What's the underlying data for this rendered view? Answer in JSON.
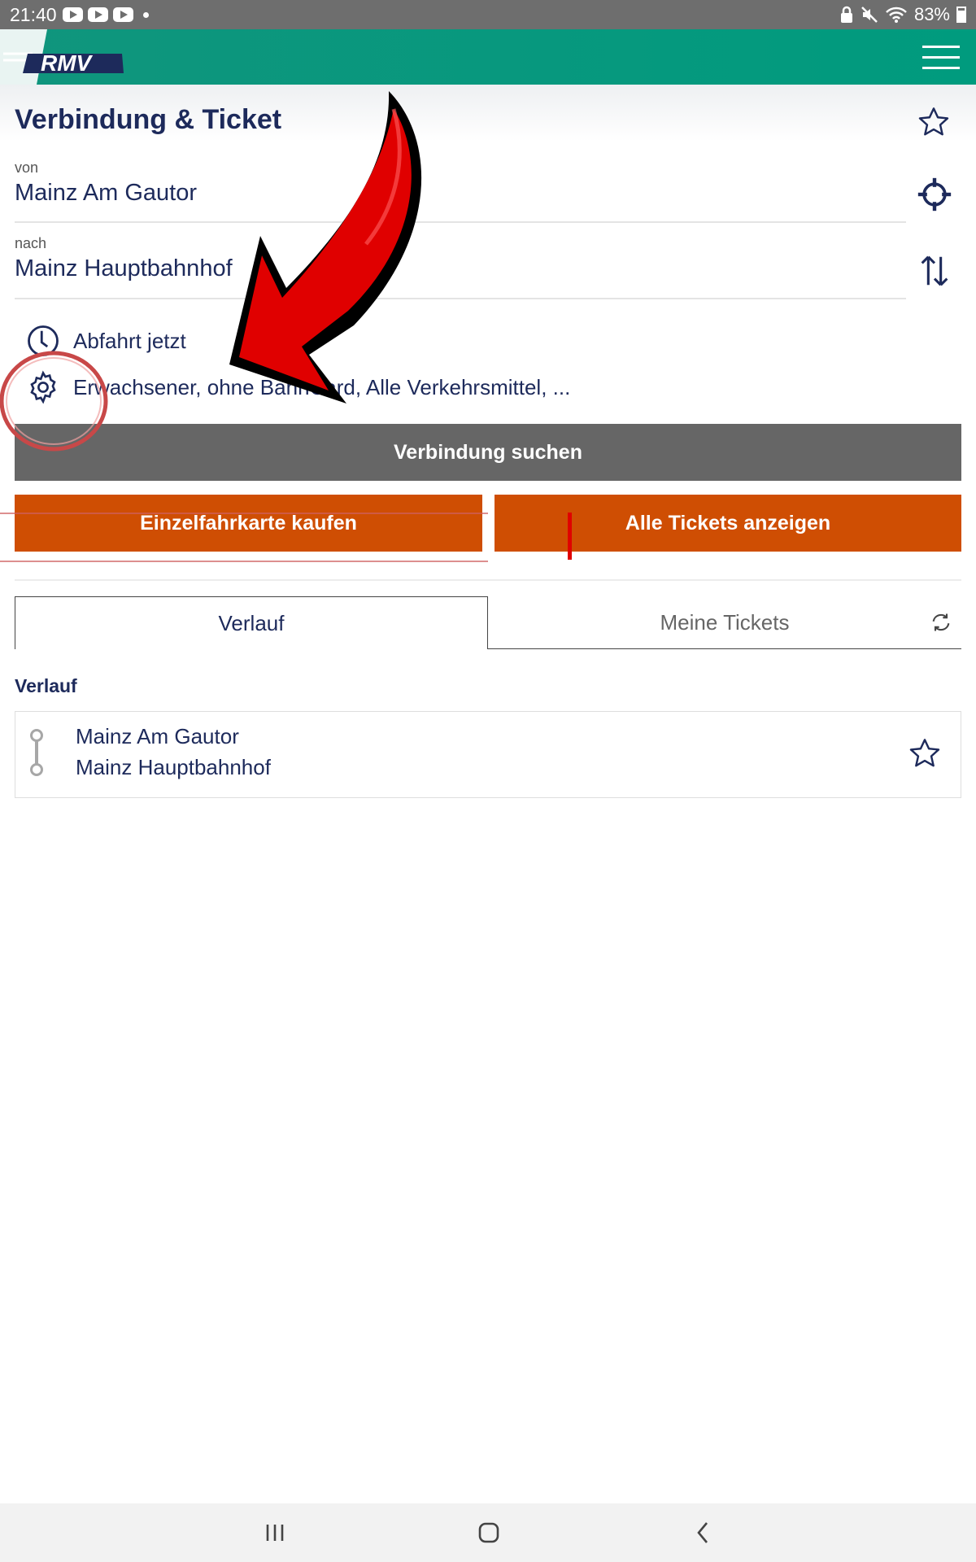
{
  "status_bar": {
    "time": "21:40",
    "battery": "83%"
  },
  "header": {
    "logo_text": "RMV"
  },
  "page": {
    "title": "Verbindung & Ticket"
  },
  "from": {
    "label": "von",
    "value": "Mainz Am Gautor"
  },
  "to": {
    "label": "nach",
    "value": "Mainz Hauptbahnhof"
  },
  "departure": {
    "text": "Abfahrt jetzt"
  },
  "options": {
    "text": "Erwachsener, ohne BahnCard, Alle Verkehrsmittel, ..."
  },
  "buttons": {
    "search": "Verbindung suchen",
    "single_ticket": "Einzelfahrkarte kaufen",
    "all_tickets": "Alle Tickets anzeigen"
  },
  "tabs": [
    {
      "label": "Verlauf",
      "active": true
    },
    {
      "label": "Meine Tickets",
      "active": false
    }
  ],
  "history": {
    "title": "Verlauf",
    "items": [
      {
        "from": "Mainz Am Gautor",
        "to": "Mainz Hauptbahnhof"
      }
    ]
  },
  "colors": {
    "header": "#009b7e",
    "primary_text": "#1d2a5b",
    "search_button": "#666666",
    "ticket_buttons": "#cf4e03",
    "annotation": "#e00000"
  }
}
